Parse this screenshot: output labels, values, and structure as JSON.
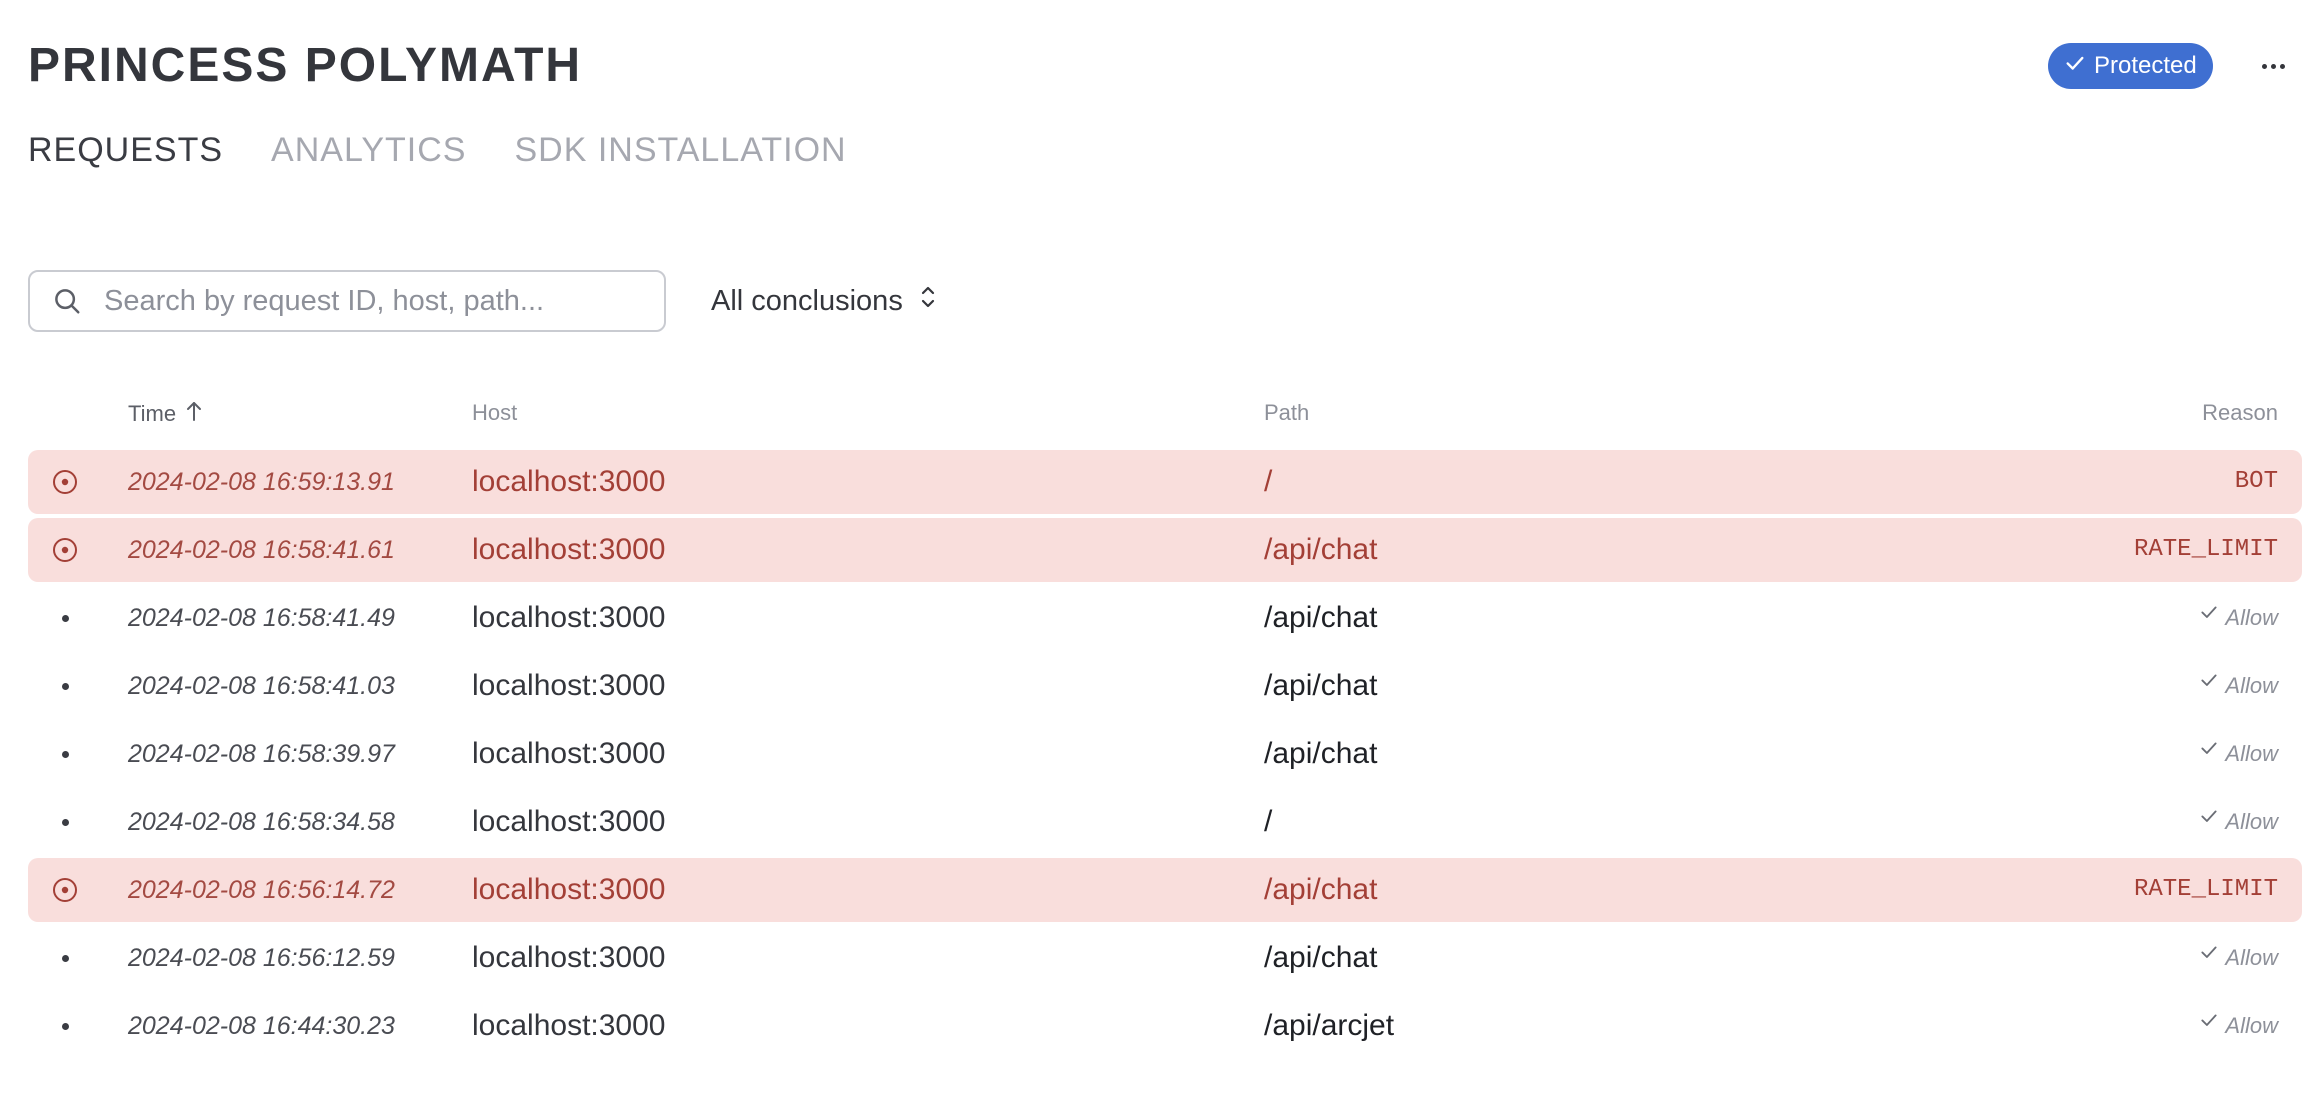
{
  "header": {
    "title": "PRINCESS POLYMATH",
    "status_badge": "Protected",
    "more_icon": "more-horizontal-icon"
  },
  "tabs": [
    {
      "label": "REQUESTS",
      "active": true
    },
    {
      "label": "ANALYTICS",
      "active": false
    },
    {
      "label": "SDK INSTALLATION",
      "active": false
    }
  ],
  "filters": {
    "search_placeholder": "Search by request ID, host, path...",
    "search_value": "",
    "conclusion_selected": "All conclusions"
  },
  "table": {
    "columns": {
      "time": "Time",
      "host": "Host",
      "path": "Path",
      "reason": "Reason"
    },
    "sort": {
      "column": "time",
      "direction": "ascending"
    },
    "rows": [
      {
        "status": "deny",
        "time": "2024-02-08 16:59:13.91",
        "host": "localhost:3000",
        "path": "/",
        "reason": "BOT"
      },
      {
        "status": "deny",
        "time": "2024-02-08 16:58:41.61",
        "host": "localhost:3000",
        "path": "/api/chat",
        "reason": "RATE_LIMIT"
      },
      {
        "status": "allow",
        "time": "2024-02-08 16:58:41.49",
        "host": "localhost:3000",
        "path": "/api/chat",
        "reason": "Allow"
      },
      {
        "status": "allow",
        "time": "2024-02-08 16:58:41.03",
        "host": "localhost:3000",
        "path": "/api/chat",
        "reason": "Allow"
      },
      {
        "status": "allow",
        "time": "2024-02-08 16:58:39.97",
        "host": "localhost:3000",
        "path": "/api/chat",
        "reason": "Allow"
      },
      {
        "status": "allow",
        "time": "2024-02-08 16:58:34.58",
        "host": "localhost:3000",
        "path": "/",
        "reason": "Allow"
      },
      {
        "status": "deny",
        "time": "2024-02-08 16:56:14.72",
        "host": "localhost:3000",
        "path": "/api/chat",
        "reason": "RATE_LIMIT"
      },
      {
        "status": "allow",
        "time": "2024-02-08 16:56:12.59",
        "host": "localhost:3000",
        "path": "/api/chat",
        "reason": "Allow"
      },
      {
        "status": "allow",
        "time": "2024-02-08 16:44:30.23",
        "host": "localhost:3000",
        "path": "/api/arcjet",
        "reason": "Allow"
      }
    ]
  },
  "colors": {
    "accent": "#3f6fd1",
    "deny_background": "#f9dedc",
    "deny_text": "#a33f36"
  }
}
